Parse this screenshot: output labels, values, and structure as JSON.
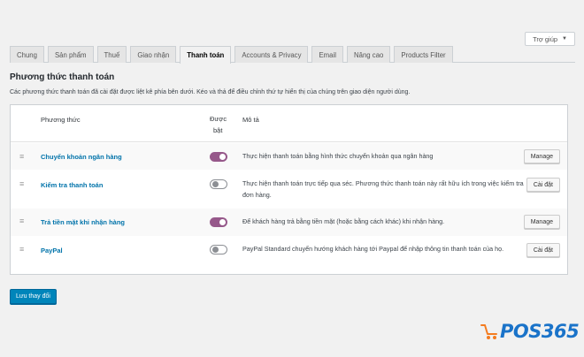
{
  "help_tab": {
    "label": "Trợ giúp",
    "caret": "▼"
  },
  "tabs": [
    {
      "label": "Chung",
      "active": false
    },
    {
      "label": "Sản phẩm",
      "active": false
    },
    {
      "label": "Thuế",
      "active": false
    },
    {
      "label": "Giao nhận",
      "active": false
    },
    {
      "label": "Thanh toán",
      "active": true
    },
    {
      "label": "Accounts & Privacy",
      "active": false
    },
    {
      "label": "Email",
      "active": false
    },
    {
      "label": "Nâng cao",
      "active": false
    },
    {
      "label": "Products Filter",
      "active": false
    }
  ],
  "section": {
    "title": "Phương thức thanh toán",
    "description": "Các phương thức thanh toán đã cài đặt được liệt kê phía bên dưới. Kéo và thả để điều chỉnh thứ tự hiển thị của chúng trên giao diện người dùng."
  },
  "table": {
    "headers": {
      "method": "Phương thức",
      "enabled_line1": "Được",
      "enabled_line2": "bật",
      "description": "Mô tả"
    },
    "rows": [
      {
        "name": "Chuyển khoản ngân hàng",
        "enabled": true,
        "description": "Thực hiện thanh toán bằng hình thức chuyển khoản qua ngân hàng",
        "action": "Manage"
      },
      {
        "name": "Kiểm tra thanh toán",
        "enabled": false,
        "description": "Thực hiện thanh toán trực tiếp qua séc. Phương thức thanh toán này rất hữu ích trong việc kiểm tra đơn hàng.",
        "action": "Cài đặt"
      },
      {
        "name": "Trả tiền mặt khi nhận hàng",
        "enabled": true,
        "description": "Để khách hàng trả bằng tiền mặt (hoặc bằng cách khác) khi nhận hàng.",
        "action": "Manage"
      },
      {
        "name": "PayPal",
        "enabled": false,
        "description": "PayPal Standard chuyển hướng khách hàng tới Paypal để nhập thông tin thanh toán của họ.",
        "action": "Cài đặt"
      }
    ],
    "drag_glyph": "≡"
  },
  "save_button": "Lưu thay đổi",
  "brand": {
    "text": "POS365",
    "icon": "cart-icon",
    "color": "#1a73c9",
    "accent": "#f47c20"
  },
  "colors": {
    "toggle_on": "#96588a",
    "link": "#0073aa",
    "primary": "#0085ba"
  }
}
